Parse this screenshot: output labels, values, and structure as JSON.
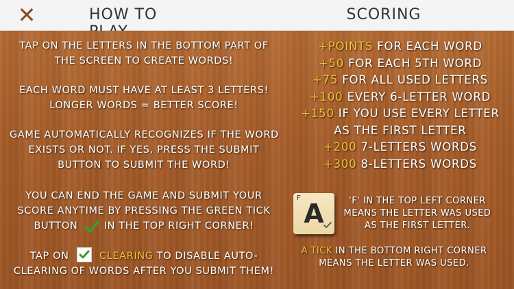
{
  "header": {
    "close_symbol": "✕",
    "how_title": "HOW TO PLAY",
    "scoring_title": "SCORING"
  },
  "how_to_play": {
    "p1": [
      "TAP ON THE LETTERS IN THE BOTTOM PART OF",
      "THE SCREEN TO CREATE WORDS!"
    ],
    "p2": [
      "EACH WORD MUST HAVE AT LEAST 3 LETTERS!",
      "LONGER WORDS = BETTER SCORE!"
    ],
    "p3": [
      "GAME AUTOMATICALLY RECOGNIZES IF THE WORD",
      "EXISTS OR NOT. IF YES, PRESS THE SUBMIT",
      "BUTTON TO SUBMIT THE WORD!"
    ],
    "p4_line1": "YOU CAN END THE GAME AND SUBMIT YOUR",
    "p4_line2": "SCORE ANYTIME BY PRESSING THE GREEN TICK",
    "p4_line3_pre": "BUTTON",
    "p4_line3_post": "IN THE TOP RIGHT CORNER!",
    "p5_pre": "TAP ON",
    "p5_clearing": "CLEARING",
    "p5_post": "TO DISABLE AUTO-",
    "p5_line2": "CLEARING OF WORDS AFTER YOU SUBMIT THEM!"
  },
  "scoring": {
    "rules": [
      {
        "points": "+POINTS",
        "text": "FOR EACH WORD"
      },
      {
        "points": "+50",
        "text": "FOR EACH 5TH WORD"
      },
      {
        "points": "+75",
        "text": "FOR ALL USED LETTERS"
      },
      {
        "points": "+100",
        "text": "EVERY 6-LETTER WORD"
      },
      {
        "points": "+150",
        "text": "IF YOU USE EVERY LETTER"
      },
      {
        "points": "",
        "text": "AS THE FIRST LETTER"
      },
      {
        "points": "+200",
        "text": "7-LETTERS WORDS"
      },
      {
        "points": "+300",
        "text": "8-LETTERS WORDS"
      }
    ]
  },
  "tile": {
    "letter": "A",
    "corner_mark": "F"
  },
  "tile_explanation": {
    "f_lines": [
      "'F' IN THE TOP LEFT CORNER",
      "MEANS THE LETTER WAS USED",
      "AS THE FIRST LETTER."
    ],
    "tick_highlight": "A TICK",
    "tick_line1_rest": "IN THE BOTTOM RIGHT CORNER",
    "tick_line2": "MEANS THE LETTER WAS USED."
  },
  "colors": {
    "accent_gold": "#f3c233",
    "close_brown": "#8a4a1f",
    "tick_green": "#3f9a2a",
    "wood": "#a65c28"
  },
  "icons": {
    "close": "close-icon",
    "green_tick": "green-tick-icon",
    "checkbox": "checkbox-checked-icon"
  }
}
